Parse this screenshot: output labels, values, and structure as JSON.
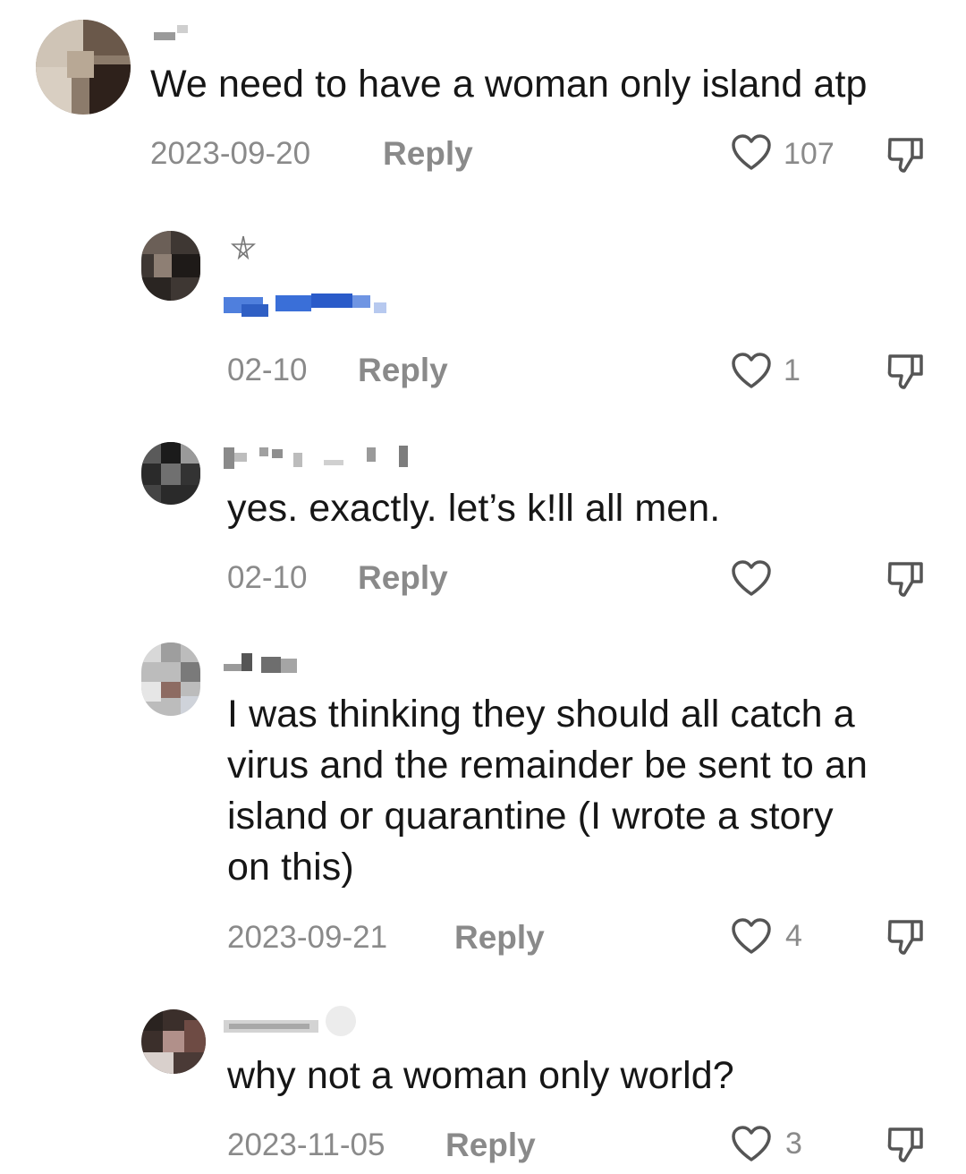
{
  "comments": [
    {
      "text": "We need to have a woman only island atp",
      "date": "2023-09-20",
      "reply_label": "Reply",
      "likes": "107"
    },
    {
      "text": "",
      "date": "02-10",
      "reply_label": "Reply",
      "likes": "1"
    },
    {
      "text": "yes. exactly. let’s k!ll all men.",
      "date": "02-10",
      "reply_label": "Reply",
      "likes": ""
    },
    {
      "text_lines": [
        "I was thinking they should all catch a",
        "virus and the remainder be sent to an",
        "island or quarantine (I wrote a story",
        "on this)"
      ],
      "date": "2023-09-21",
      "reply_label": "Reply",
      "likes": "4"
    },
    {
      "text": "why not a woman only world?",
      "date": "2023-11-05",
      "reply_label": "Reply",
      "likes": "3"
    }
  ],
  "icons": {
    "like": "heart-outline-icon",
    "dislike": "thumbs-down-outline-icon"
  },
  "colors": {
    "text": "#161616",
    "meta": "#8a8a8a",
    "icon": "#555555",
    "blur_blue": "#3a6fd8"
  }
}
